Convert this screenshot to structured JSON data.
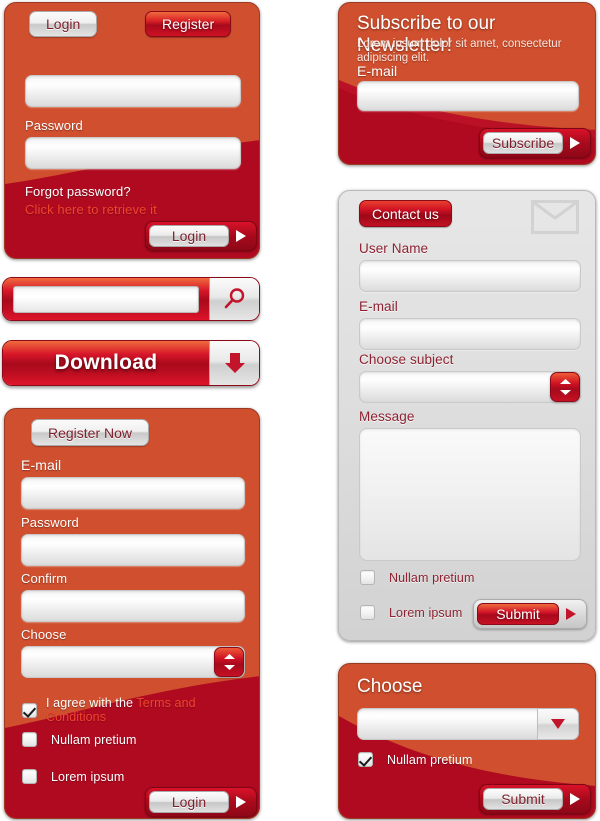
{
  "login_panel": {
    "tab_login": "Login",
    "tab_register": "Register",
    "username_value": "",
    "password_label": "Password",
    "password_value": "",
    "forgot_label": "Forgot password?",
    "forgot_link": "Click here to retrieve it",
    "submit_label": "Login",
    "panel_color": "#cf4f2e",
    "panel_color_dark": "#a90a1c"
  },
  "newsletter_panel": {
    "title": "Subscribe to our Newsletter!",
    "description": "Lorem ipsum dolor sit amet, consectetur adipiscing elit.",
    "email_label": "E-mail",
    "email_value": "",
    "submit_label": "Subscribe"
  },
  "search_bar": {
    "value": "",
    "icon": "search-icon"
  },
  "download_bar": {
    "label": "Download",
    "icon": "download-arrow-icon"
  },
  "register_panel": {
    "tab_label": "Register Now",
    "email_label": "E-mail",
    "email_value": "",
    "password_label": "Password",
    "password_value": "",
    "confirm_label": "Confirm",
    "confirm_value": "",
    "choose_label": "Choose",
    "choose_value": "",
    "agree_text": "I agree with the ",
    "agree_link": "Terms and Conditions",
    "agree_checked": true,
    "option1": "Nullam pretium",
    "option1_checked": false,
    "option2": "Lorem ipsum",
    "option2_checked": false,
    "submit_label": "Login"
  },
  "contact_panel": {
    "tab_label": "Contact us",
    "icon": "envelope-icon",
    "username_label": "User Name",
    "username_value": "",
    "email_label": "E-mail",
    "email_value": "",
    "subject_label": "Choose subject",
    "subject_value": "",
    "message_label": "Message",
    "message_value": "",
    "option1": "Nullam pretium",
    "option1_checked": false,
    "option2": "Lorem ipsum",
    "option2_checked": false,
    "submit_label": "Submit"
  },
  "choose_panel": {
    "title": "Choose",
    "select_value": "",
    "option1": "Nullam pretium",
    "option1_checked": true,
    "submit_label": "Submit"
  }
}
